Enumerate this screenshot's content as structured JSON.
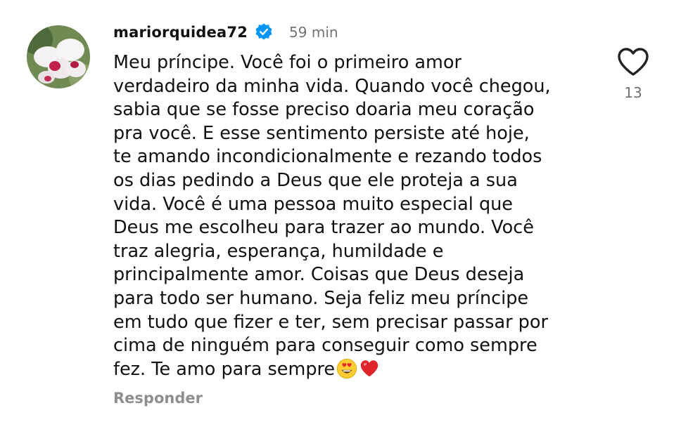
{
  "comment": {
    "username": "mariorquidea72",
    "verified": true,
    "timestamp": "59 min",
    "text": "Meu príncipe. Você foi o primeiro amor\nverdadeiro da minha vida. Quando você chegou,\nsabia que se fosse preciso doaria meu coração\npra você. E esse sentimento persiste até hoje,\nte amando incondicionalmente e rezando todos\nos dias pedindo a Deus que ele proteja a sua\nvida. Você é uma pessoa muito especial que\nDeus me escolheu para trazer ao mundo. Você\ntraz alegria, esperança, humildade e\nprincipalmente amor. Coisas que Deus deseja\npara todo ser humano. Seja feliz meu príncipe\nem tudo que fizer e ter, sem precisar passar por\ncima de ninguém para conseguir como sempre\nfez. Te amo para sempre",
    "trailing_emojis": [
      "😍",
      "❤️"
    ],
    "likes": "13",
    "reply_label": "Responder"
  },
  "icons": {
    "avatar": "orchid-avatar",
    "verified": "verified-badge-icon",
    "like": "heart-outline-icon"
  },
  "colors": {
    "text": "#111111",
    "secondary": "#737373",
    "reply": "#8e8e8e",
    "verified_blue": "#0095f6",
    "heart_red": "#e0262b"
  }
}
